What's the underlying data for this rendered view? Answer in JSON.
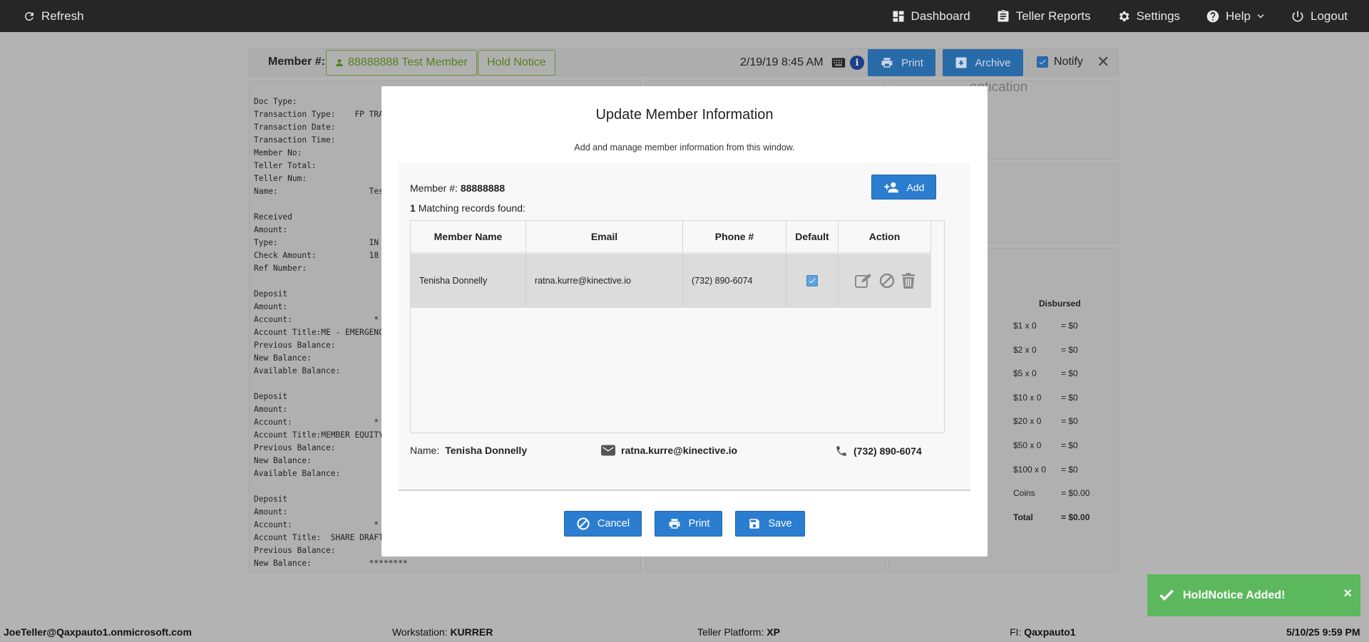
{
  "topbar": {
    "refresh": "Refresh",
    "dashboard": "Dashboard",
    "teller_reports": "Teller Reports",
    "settings": "Settings",
    "help": "Help",
    "logout": "Logout"
  },
  "memberbar": {
    "label": "Member #:",
    "member": "88888888 Test Member",
    "hold_notice": "Hold Notice",
    "datetime": "2/19/19 8:45 AM",
    "info": "i",
    "print": "Print",
    "archive": "Archive",
    "notify": "Notify",
    "close": "✕"
  },
  "receipt_lines": [
    "Doc Type:",
    "Transaction Type:    FP TRA",
    "Transaction Date:",
    "Transaction Time:",
    "Member No:",
    "Teller Total:",
    "Teller Num:",
    "Name:                   Tes",
    "",
    "Received",
    "Amount:",
    "Type:                   IN",
    "Check Amount:           18",
    "Ref Number:",
    "",
    "Deposit",
    "Amount:",
    "Account:                 *",
    "Account Title:ME - EMERGENC",
    "Previous Balance:",
    "New Balance:",
    "Available Balance:",
    "",
    "Deposit",
    "Amount:",
    "Account:                 *",
    "Account Title:MEMBER EQUITY",
    "Previous Balance:",
    "New Balance:",
    "Available Balance:",
    "",
    "Deposit",
    "Amount:",
    "Account:                 *",
    "Account Title:  SHARE DRAFT",
    "Previous Balance:",
    "New Balance:            ********"
  ],
  "auth_text": "entication",
  "disbursed": {
    "header": "Disbursed",
    "rows": [
      {
        "label": "$1 x 0",
        "value": "= $0"
      },
      {
        "label": "$2 x 0",
        "value": "= $0"
      },
      {
        "label": "$5 x 0",
        "value": "= $0"
      },
      {
        "label": "$10 x 0",
        "value": "= $0"
      },
      {
        "label": "$20 x 0",
        "value": "= $0"
      },
      {
        "label": "$50 x 0",
        "value": "= $0"
      },
      {
        "label": "$100 x 0",
        "value": "= $0"
      },
      {
        "label": "Coins",
        "value": "= $0.00"
      },
      {
        "label": "Total",
        "value": "= $0.00"
      }
    ]
  },
  "modal": {
    "title": "Update Member Information",
    "subtitle": "Add and manage member information from this window.",
    "member_label": "Member #:",
    "member_number": "88888888",
    "match_count": "1",
    "match_text": "Matching records found:",
    "add": "Add",
    "columns": [
      "Member Name",
      "Email",
      "Phone #",
      "Default",
      "Action"
    ],
    "rows": [
      {
        "name": "Tenisha Donnelly",
        "email": "ratna.kurre@kinective.io",
        "phone": "(732) 890-6074",
        "default": true
      }
    ],
    "summary": {
      "name_label": "Name:",
      "name": "Tenisha Donnelly",
      "email": "ratna.kurre@kinective.io",
      "phone": "(732) 890-6074"
    },
    "cancel": "Cancel",
    "print": "Print",
    "save": "Save"
  },
  "toast": {
    "message": "HoldNotice Added!",
    "close": "×"
  },
  "footer": {
    "user": "JoeTeller@Qaxpauto1.onmicrosoft.com",
    "workstation_label": "Workstation:",
    "workstation": "KURRER",
    "platform_label": "Teller Platform:",
    "platform": "XP",
    "fi_label": "FI:",
    "fi": "Qaxpauto1",
    "datetime": "5/10/25 9:59 PM"
  }
}
